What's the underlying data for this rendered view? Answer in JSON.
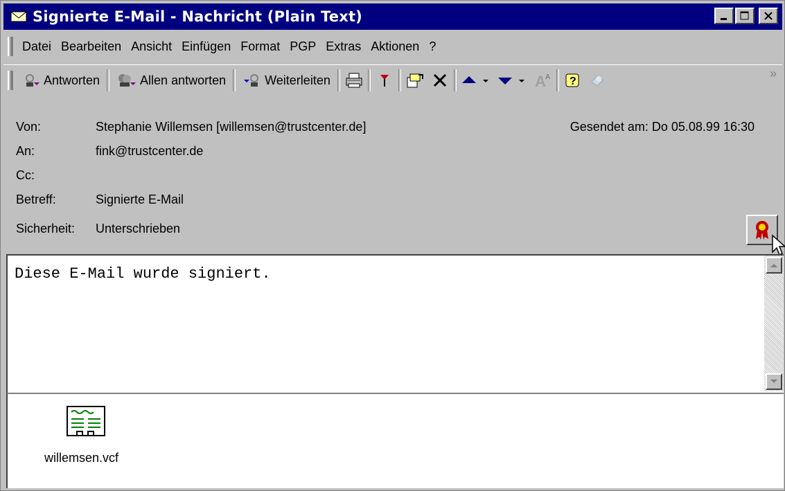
{
  "window": {
    "title": "Signierte E-Mail - Nachricht (Plain Text)"
  },
  "menu": {
    "items": [
      "Datei",
      "Bearbeiten",
      "Ansicht",
      "Einfügen",
      "Format",
      "PGP",
      "Extras",
      "Aktionen",
      "?"
    ]
  },
  "toolbar": {
    "reply": "Antworten",
    "reply_all": "Allen antworten",
    "forward": "Weiterleiten",
    "more": "»"
  },
  "headers": {
    "from_label": "Von:",
    "from_value": "Stephanie Willemsen [willemsen@trustcenter.de]",
    "sent_label": "Gesendet am:",
    "sent_value": "Do 05.08.99 16:30",
    "to_label": "An:",
    "to_value": "fink@trustcenter.de",
    "cc_label": "Cc:",
    "cc_value": "",
    "subject_label": "Betreff:",
    "subject_value": "Signierte E-Mail",
    "security_label": "Sicherheit:",
    "security_value": "Unterschrieben"
  },
  "body": {
    "text": "Diese E-Mail wurde signiert."
  },
  "attachment": {
    "name": "willemsen.vcf",
    "icon": "vcard-icon"
  },
  "colors": {
    "titlebar": "#000080",
    "chrome": "#c0c0c0"
  }
}
